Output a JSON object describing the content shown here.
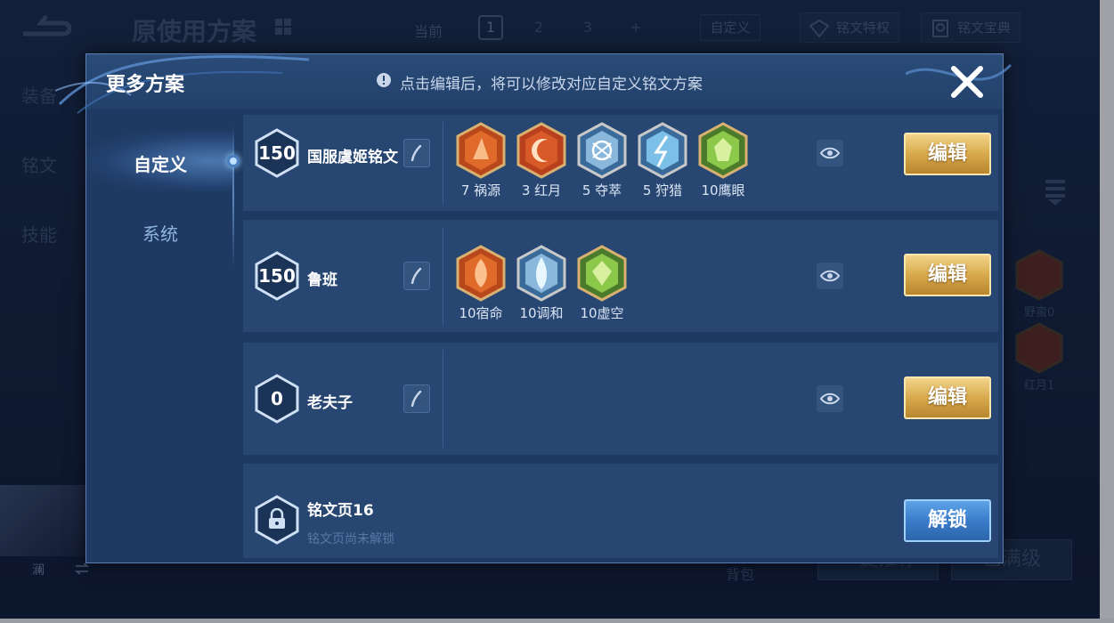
{
  "background": {
    "title": "原使用方案",
    "current_label": "当前",
    "page_tabs": [
      "1",
      "2",
      "3",
      "+"
    ],
    "custom_label": "自定义",
    "rune_perks_label": "铭文特权",
    "rune_book_label": "铭文宝典",
    "sidebar": [
      "装备",
      "铭文",
      "技能"
    ],
    "hero_label": "澜",
    "right_runes": [
      "野蛮0",
      "红月1"
    ],
    "bag_label": "背包",
    "bottom_buttons": [
      "一键推荐",
      "已满级"
    ]
  },
  "modal": {
    "title": "更多方案",
    "tip": "点击编辑后，将可以修改对应自定义铭文方案",
    "nav": [
      {
        "label": "自定义",
        "active": true
      },
      {
        "label": "系统",
        "active": false
      }
    ],
    "edit_label": "编辑",
    "unlock_label": "解锁",
    "plans": [
      {
        "level": "150",
        "name": "国服虞姬铭文",
        "runes": [
          {
            "label": "7 祸源",
            "color": "red"
          },
          {
            "label": "3 红月",
            "color": "red"
          },
          {
            "label": "5 夺萃",
            "color": "blue"
          },
          {
            "label": "5 狩猎",
            "color": "blue"
          },
          {
            "label": "10鹰眼",
            "color": "green"
          }
        ]
      },
      {
        "level": "150",
        "name": "鲁班",
        "runes": [
          {
            "label": "10宿命",
            "color": "red"
          },
          {
            "label": "10调和",
            "color": "blue"
          },
          {
            "label": "10虚空",
            "color": "green"
          }
        ]
      },
      {
        "level": "0",
        "name": "老夫子",
        "runes": []
      }
    ],
    "locked_page": {
      "name": "铭文页16",
      "subtitle": "铭文页尚未解锁"
    }
  },
  "colors": {
    "gold_button": "#d7a94c",
    "blue_button": "#3a7ccb",
    "panel": "#1f3a62",
    "row": "#274672"
  }
}
